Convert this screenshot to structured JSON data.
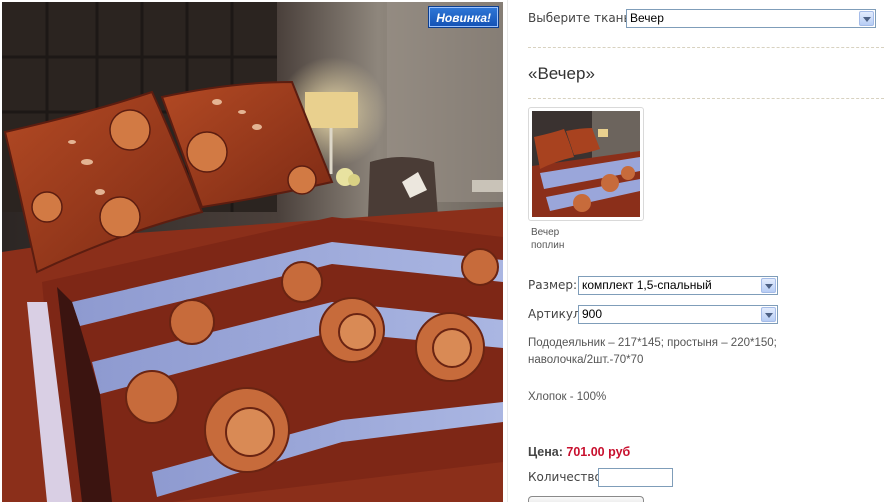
{
  "badge": {
    "label": "Новинка!"
  },
  "fabric": {
    "label": "Выберите ткань:",
    "selected": "Вечер"
  },
  "product": {
    "title": "«Вечер»",
    "thumbnail_caption_line1": "Вечер",
    "thumbnail_caption_line2": "поплин"
  },
  "size": {
    "label": "Размер:",
    "selected": "комплект 1,5-спальный"
  },
  "article": {
    "label": "Артикул:",
    "selected": "900"
  },
  "description": {
    "line1": "Пододеяльник – 217*145; простыня – 220*150;",
    "line2": "наволочка/2шт.-70*70",
    "material": "Хлопок - 100%"
  },
  "price": {
    "label": "Цена:",
    "value": "701.00 руб"
  },
  "quantity": {
    "label": "Количество:",
    "value": ""
  },
  "colors": {
    "accent_price": "#c8102e",
    "badge_blue": "#1f63c8",
    "select_border": "#7f9db9"
  }
}
